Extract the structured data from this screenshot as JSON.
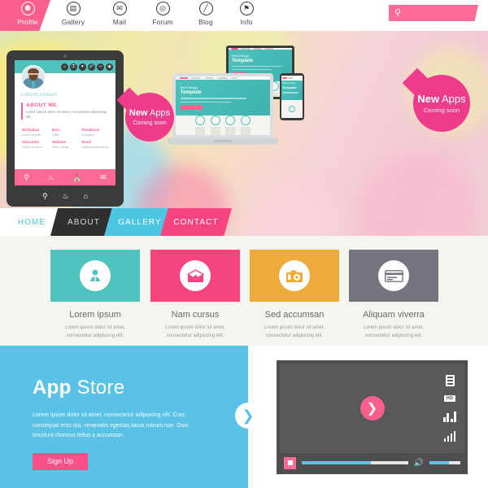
{
  "topnav": {
    "items": [
      {
        "label": "Profile",
        "icon": "people-icon",
        "glyph": "⚉",
        "active": true
      },
      {
        "label": "Gallery",
        "icon": "image-icon",
        "glyph": "▤",
        "active": false
      },
      {
        "label": "Mail",
        "icon": "mail-icon",
        "glyph": "✉",
        "active": false
      },
      {
        "label": "Forum",
        "icon": "chat-icon",
        "glyph": "◎",
        "active": false
      },
      {
        "label": "Blog",
        "icon": "pencil-icon",
        "glyph": "╱",
        "active": false
      },
      {
        "label": "Info",
        "icon": "info-pin-icon",
        "glyph": "⚑",
        "active": false
      }
    ],
    "search": {
      "placeholder": "",
      "value": "",
      "icon": "search-icon",
      "glyph": "⚲"
    }
  },
  "hero": {
    "badge_left": {
      "strong": "New",
      "light": " Apps",
      "sub": "Coming soon"
    },
    "badge_right": {
      "strong": "New",
      "light": " Apps",
      "sub": "Coming soon"
    },
    "mini_site": {
      "nav": [
        "Home",
        "Services",
        "Contact",
        "Portfolio",
        "FAQ"
      ],
      "kicker": "Web Design",
      "title": "Template",
      "button": "Read more"
    },
    "tablet": {
      "name": "Lobortis Aliquam",
      "section_title": "ABOUT ME",
      "section_text": "Lorem ipsum dolor sit amet, consectetur adipiscing elit.",
      "fields": [
        {
          "key": "Birthplace",
          "value": "Lorem ipsum"
        },
        {
          "key": "Born",
          "value": "1986"
        },
        {
          "key": "Residence",
          "value": "Hungary"
        },
        {
          "key": "Education",
          "value": "Dolor sit amet"
        },
        {
          "key": "Hobbies",
          "value": "Web Design"
        },
        {
          "key": "Email",
          "value": "Adipiscing@elit.sit"
        }
      ],
      "toolbar_icons": [
        "search-icon",
        "people-icon",
        "store-icon",
        "mail-icon"
      ],
      "header_icons": [
        "home-icon",
        "lock-icon",
        "heart-icon",
        "link-icon",
        "share-icon",
        "camera-icon"
      ]
    }
  },
  "menubar": {
    "items": [
      {
        "label": "HOME",
        "bg": "#ffffff",
        "color": "#4ec5e0"
      },
      {
        "label": "ABOUT",
        "bg": "#2f2f2f",
        "color": "#d8d8d8"
      },
      {
        "label": "GALLERY",
        "bg": "#4ec5e0",
        "color": "#ffffff"
      },
      {
        "label": "CONTACT",
        "bg": "#f5447e",
        "color": "#ffffff"
      }
    ]
  },
  "features": {
    "cards": [
      {
        "title": "Lorem ipsum",
        "desc": "Lorem ipsum dolor sit amet, consectetur adipiscing elit.",
        "color": "#4ec3bd",
        "icon": "person-icon"
      },
      {
        "title": "Nam cursus",
        "desc": "Lorem ipsum dolor sit amet, consectetur adipiscing elit.",
        "color": "#f5447e",
        "icon": "envelope-icon"
      },
      {
        "title": "Sed accumsan",
        "desc": "Lorem ipsum dolor sit amet, consectetur adipiscing elit.",
        "color": "#edab3b",
        "icon": "camera-icon"
      },
      {
        "title": "Aliquam viverra",
        "desc": "Lorem ipsum dolor sit amet, consectetur adipiscing elit.",
        "color": "#76757f",
        "icon": "credit-card-icon"
      }
    ]
  },
  "appstore": {
    "title_strong": "App",
    "title_light": " Store",
    "desc": "Lorem ipsum dolor sit amet, consectetur adipiscing elit. Cras consequat eros dui, venenatis egestas lacus rutrum non. Duis tincidunt rhoncus tellus a accumsan.",
    "button": "Sign Up",
    "arrow_icon": "chevron-right-icon",
    "arrow_glyph": "❯",
    "bg": "#5bc2e7"
  },
  "video": {
    "play_icon": "play-chevron-icon",
    "play_glyph": "❯",
    "stop_icon": "stop-icon",
    "volume_icon": "volume-icon",
    "volume_glyph": "🔊",
    "hd_label": "HD",
    "side_icons": [
      "film-strip-icon",
      "hd-badge-icon",
      "equalizer-icon",
      "signal-bars-icon"
    ],
    "progress_percent": 65,
    "volume_percent": 62
  }
}
